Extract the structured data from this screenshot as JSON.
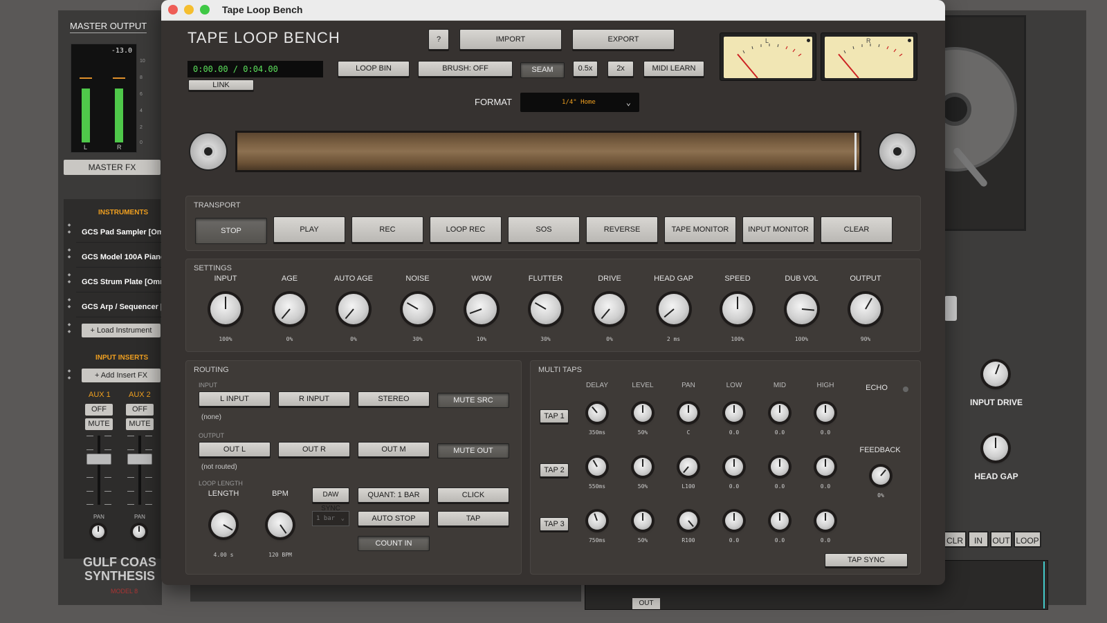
{
  "host": {
    "master_title": "MASTER OUTPUT",
    "master_readout": "-13.0",
    "meter_l": "L",
    "meter_r": "R",
    "master_level": 0.6,
    "scale": [
      "10",
      "8",
      "6",
      "4",
      "2",
      "0"
    ],
    "master_fx": "MASTER FX",
    "instruments_title": "INSTRUMENTS",
    "instruments": [
      "GCS Pad Sampler [Omn",
      "GCS Model 100A Piano [Omn",
      "GCS Strum Plate [Omn",
      "GCS Arp / Sequencer [Omn"
    ],
    "load_instrument": "+ Load Instrument",
    "input_inserts_title": "INPUT INSERTS",
    "add_insert": "+ Add Insert FX",
    "aux1": "AUX 1",
    "aux2": "AUX 2",
    "off": "OFF",
    "mute": "MUTE",
    "pan": "PAN",
    "brand_line1": "GULF COAS",
    "brand_line2": "SYNTHESIS",
    "brand_sub": "MODEL 8",
    "input_drive": "INPUT DRIVE",
    "head_gap": "HEAD GAP",
    "right_buttons": [
      "CLR",
      "IN",
      "OUT",
      "LOOP"
    ],
    "out_tag": "OUT"
  },
  "window": {
    "title": "Tape Loop Bench",
    "app_title": "TAPE  LOOP  BENCH",
    "help": "?",
    "import": "IMPORT",
    "export": "EXPORT",
    "timecode": "0:00.00 / 0:04.00",
    "link": "LINK",
    "toolbar": [
      "LOOP BIN",
      "BRUSH: OFF",
      "SEAM",
      "0.5x",
      "2x",
      "MIDI LEARN"
    ],
    "format_label": "FORMAT",
    "format_value": "1/4\" Home",
    "vu_left": "L",
    "vu_right": "R"
  },
  "transport": {
    "title": "TRANSPORT",
    "buttons": [
      "STOP",
      "PLAY",
      "REC",
      "LOOP REC",
      "SOS",
      "REVERSE",
      "TAPE MONITOR",
      "INPUT MONITOR",
      "CLEAR"
    ]
  },
  "settings": {
    "title": "SETTINGS",
    "knobs": [
      {
        "label": "INPUT",
        "value": "100%",
        "angle": 0
      },
      {
        "label": "AGE",
        "value": "0%",
        "angle": -140
      },
      {
        "label": "AUTO AGE",
        "value": "0%",
        "angle": -140
      },
      {
        "label": "NOISE",
        "value": "30%",
        "angle": -60
      },
      {
        "label": "WOW",
        "value": "10%",
        "angle": -110
      },
      {
        "label": "FLUTTER",
        "value": "30%",
        "angle": -60
      },
      {
        "label": "DRIVE",
        "value": "0%",
        "angle": -140
      },
      {
        "label": "HEAD GAP",
        "value": "2 ms",
        "angle": -130
      },
      {
        "label": "SPEED",
        "value": "100%",
        "angle": 0
      },
      {
        "label": "DUB VOL",
        "value": "100%",
        "angle": 95
      },
      {
        "label": "OUTPUT",
        "value": "90%",
        "angle": 30
      }
    ]
  },
  "routing": {
    "title": "ROUTING",
    "input_label": "INPUT",
    "input_buttons": [
      "L INPUT",
      "R INPUT",
      "STEREO",
      "MUTE SRC"
    ],
    "input_note": "(none)",
    "output_label": "OUTPUT",
    "output_buttons": [
      "OUT L",
      "OUT R",
      "OUT M",
      "MUTE OUT"
    ],
    "output_note": "(not routed)",
    "loop_length_label": "LOOP LENGTH",
    "length_label": "LENGTH",
    "length_value": "4.00 s",
    "bpm_label": "BPM",
    "bpm_value": "120 BPM",
    "daw_sync": "DAW SYNC",
    "quant": "QUANT: 1 BAR",
    "click": "CLICK",
    "bar_select": "1 bar",
    "auto_stop": "AUTO STOP",
    "tap": "TAP",
    "count_in": "COUNT IN"
  },
  "multi_taps": {
    "title": "MULTI TAPS",
    "columns": [
      "DELAY",
      "LEVEL",
      "PAN",
      "LOW",
      "MID",
      "HIGH"
    ],
    "echo": "ECHO",
    "feedback": "FEEDBACK",
    "feedback_value": "0%",
    "tap_sync": "TAP SYNC",
    "taps": [
      {
        "label": "TAP 1",
        "values": [
          "350ms",
          "50%",
          "C",
          "0.0",
          "0.0",
          "0.0"
        ],
        "angles": [
          -40,
          0,
          0,
          0,
          0,
          0
        ]
      },
      {
        "label": "TAP 2",
        "values": [
          "550ms",
          "50%",
          "L100",
          "0.0",
          "0.0",
          "0.0"
        ],
        "angles": [
          -30,
          0,
          -140,
          0,
          0,
          0
        ]
      },
      {
        "label": "TAP 3",
        "values": [
          "750ms",
          "50%",
          "R100",
          "0.0",
          "0.0",
          "0.0"
        ],
        "angles": [
          -20,
          0,
          140,
          0,
          0,
          0
        ]
      }
    ]
  }
}
